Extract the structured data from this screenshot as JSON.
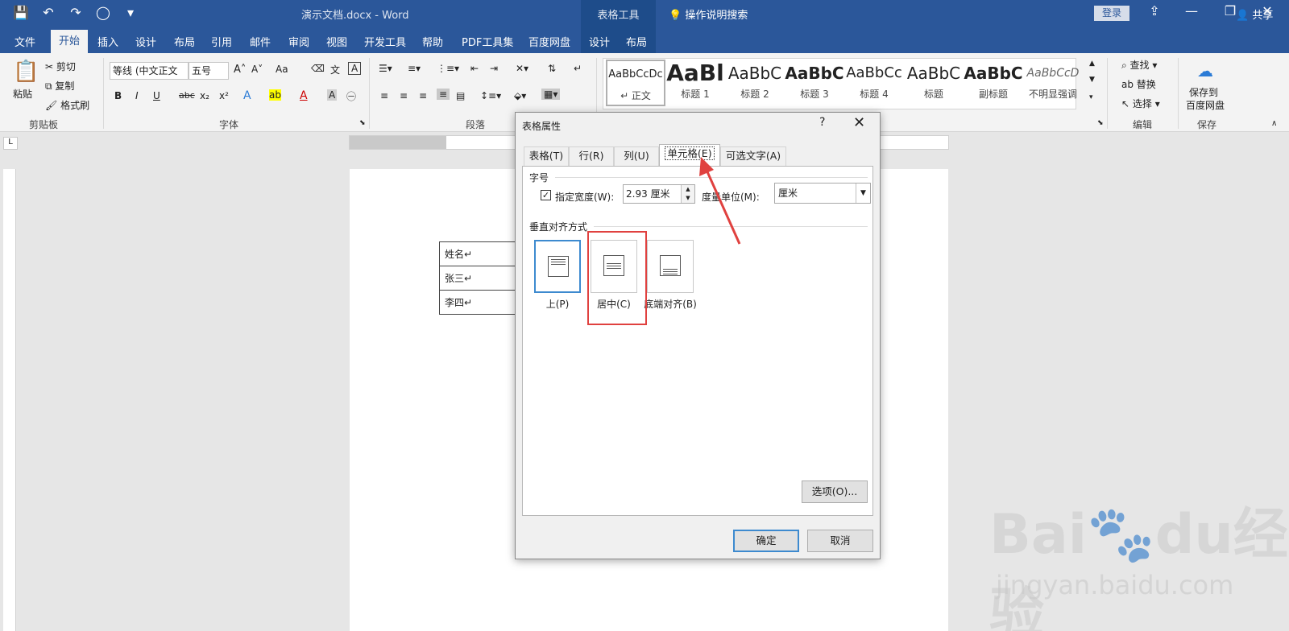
{
  "titlebar": {
    "doc_title": "演示文档.docx - Word",
    "context_tools": "表格工具",
    "login": "登录",
    "qat": {
      "save": "💾",
      "undo": "↶",
      "redo": "↷",
      "circle": "◯",
      "more": "▾"
    }
  },
  "menu": {
    "tabs": [
      "文件",
      "开始",
      "插入",
      "设计",
      "布局",
      "引用",
      "邮件",
      "审阅",
      "视图",
      "开发工具",
      "帮助",
      "PDF工具集",
      "百度网盘",
      "设计",
      "布局"
    ],
    "tell_me": "操作说明搜索",
    "share": "共享"
  },
  "ribbon": {
    "clipboard": {
      "paste": "粘贴",
      "cut": "剪切",
      "copy": "复制",
      "format_painter": "格式刷",
      "label": "剪贴板"
    },
    "font": {
      "font_name": "等线 (中文正文",
      "font_size": "五号",
      "label": "字体",
      "case": "Aa",
      "bold": "B",
      "italic": "I",
      "underline": "U",
      "strike": "abc",
      "sub": "x₂",
      "sup": "x²"
    },
    "paragraph": {
      "label": "段落"
    },
    "styles": [
      {
        "sample": "AaBbCcDc",
        "name": "↵ 正文"
      },
      {
        "sample": "AaBl",
        "name": "标题 1"
      },
      {
        "sample": "AaBbC",
        "name": "标题 2"
      },
      {
        "sample": "AaBbC",
        "name": "标题 3"
      },
      {
        "sample": "AaBbCc",
        "name": "标题 4"
      },
      {
        "sample": "AaBbC",
        "name": "标题"
      },
      {
        "sample": "AaBbC",
        "name": "副标题"
      },
      {
        "sample": "AaBbCcD",
        "name": "不明显强调"
      }
    ],
    "editing": {
      "find": "查找",
      "replace": "替换",
      "select": "选择",
      "label": "编辑"
    },
    "save": {
      "line1": "保存到",
      "line2": "百度网盘",
      "label": "保存"
    }
  },
  "ruler": {
    "corner": "L"
  },
  "document": {
    "rows": [
      "姓名↵",
      "张三↵",
      "李四↵"
    ]
  },
  "dialog": {
    "title": "表格属性",
    "help": "?",
    "close": "✕",
    "tabs": [
      "表格(T)",
      "行(R)",
      "列(U)",
      "单元格(E)",
      "可选文字(A)"
    ],
    "size_section": "字号",
    "specify_width_label": "指定宽度(W):",
    "width_value": "2.93 厘米",
    "unit_label": "度量单位(M):",
    "unit_value": "厘米",
    "valign_section": "垂直对齐方式",
    "valign_options": [
      "上(P)",
      "居中(C)",
      "底端对齐(B)"
    ],
    "options_button": "选项(O)...",
    "ok": "确定",
    "cancel": "取消"
  },
  "watermark": {
    "brand": "Bai",
    "brand2": "du",
    "cn": "经验",
    "url": "jingyan.baidu.com"
  },
  "colors": {
    "word_blue": "#2b579a",
    "highlight_red": "#e0413f",
    "selected_blue": "#3d8acf"
  }
}
